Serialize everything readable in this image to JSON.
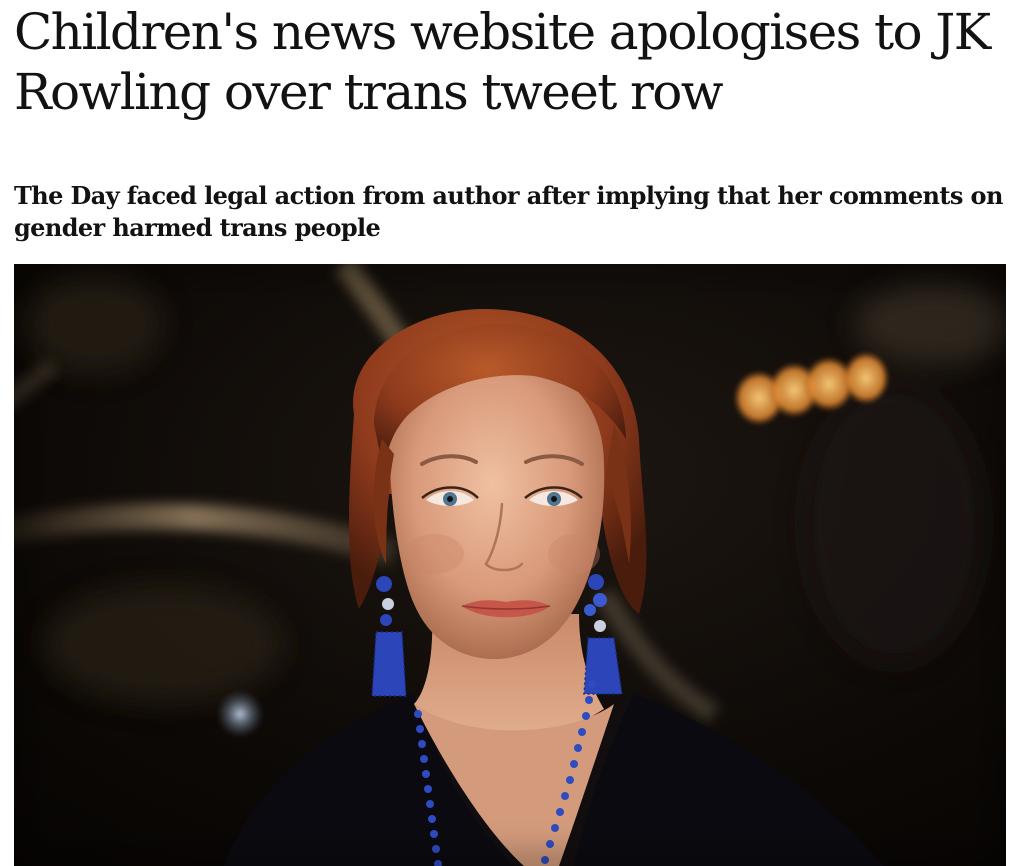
{
  "article": {
    "headline": "Children's news website apologises to JK Rowling over trans tweet row",
    "standfirst": "The Day faced legal action from author after implying that her comments on gender harmed trans people"
  },
  "image": {
    "subject": "portrait-photo",
    "background_color": "#0a0705",
    "hair_color": "#8e3a1c",
    "skin_color": "#e0a88a",
    "jewelry_color": "#2c45b8",
    "bokeh_color": "#f0a24a"
  }
}
